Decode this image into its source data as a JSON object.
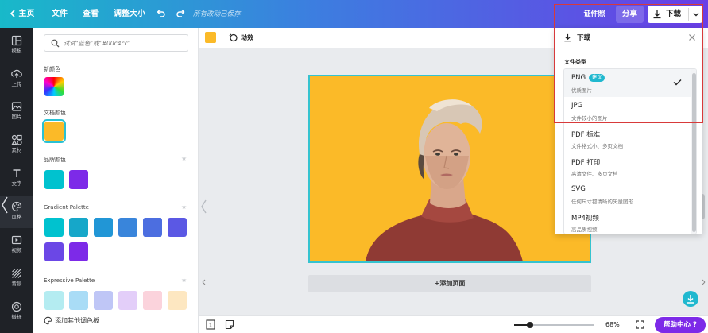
{
  "topbar": {
    "home_label": "主页",
    "file_label": "文件",
    "view_label": "查看",
    "resize_label": "调整大小",
    "status_text": "所有改动已保存",
    "cert_label": "证件照",
    "share_label": "分享",
    "download_label": "下载"
  },
  "rail": {
    "items": [
      {
        "label": "模板",
        "icon": "template-icon"
      },
      {
        "label": "上传",
        "icon": "upload-icon"
      },
      {
        "label": "图片",
        "icon": "photo-icon"
      },
      {
        "label": "素材",
        "icon": "elements-icon"
      },
      {
        "label": "文字",
        "icon": "text-icon"
      },
      {
        "label": "风格",
        "icon": "palette-icon"
      },
      {
        "label": "视频",
        "icon": "video-icon"
      },
      {
        "label": "背景",
        "icon": "background-icon"
      },
      {
        "label": "徽标",
        "icon": "logo-icon"
      }
    ]
  },
  "colors_panel": {
    "search_placeholder": "试试\"蓝色\"或\"#00c4cc\"",
    "new_color_title": "新颜色",
    "doc_colors_title": "文档颜色",
    "doc_colors": [
      "#fbba28"
    ],
    "brand_colors_title": "品牌颜色",
    "brand_colors": [
      "#00c2cf",
      "#7d2ae8"
    ],
    "gradient_title": "Gradient Palette",
    "gradient_colors": [
      "#00c2cf",
      "#16a7c9",
      "#2196d6",
      "#3985db",
      "#4c6ee0",
      "#5b58e4",
      "#6b47e6",
      "#7d2ae8"
    ],
    "expressive_title": "Expressive Palette",
    "expressive_colors": [
      "#b4ecf1",
      "#a9dcf6",
      "#bfc6f6",
      "#e3cef9",
      "#fbd3dc",
      "#fde7c1"
    ],
    "add_palette_label": "添加其他调色板"
  },
  "edit_toolbar": {
    "current_color": "#fbba28",
    "animate_label": "动效"
  },
  "canvas": {
    "background_color": "#fbba28",
    "border_color": "#35c3cf",
    "add_page_label": "+添加页面"
  },
  "bottombar": {
    "zoom_percent": 68,
    "zoom_text": "68%",
    "zoom_fraction": 0.2,
    "help_label": "帮助中心 ?"
  },
  "download_panel": {
    "title": "下载",
    "file_type_label": "文件类型",
    "options": [
      {
        "name": "PNG",
        "badge": "建议",
        "desc": "优质图片",
        "selected": true
      },
      {
        "name": "JPG",
        "desc": "文件较小的图片"
      },
      {
        "name": "PDF 标准",
        "desc": "文件格式小、多页文档"
      },
      {
        "name": "PDF 打印",
        "desc": "高清文件、多页文档"
      },
      {
        "name": "SVG",
        "desc": "任何尺寸都清晰的矢量图形"
      },
      {
        "name": "MP4视频",
        "desc": "高品质视频"
      }
    ]
  },
  "colors": {
    "accent_teal": "#20b8cf",
    "accent_purple": "#7d2ae8",
    "highlight_red": "#d83a3a"
  }
}
